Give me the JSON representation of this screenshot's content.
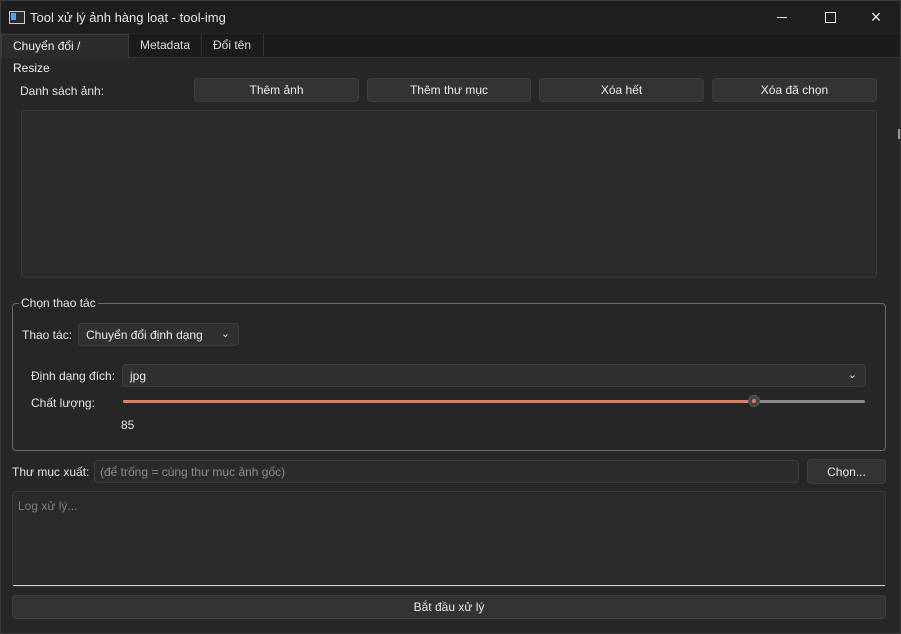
{
  "window": {
    "title": "Tool xử lý ảnh hàng loạt - tool-img",
    "controls": {
      "minimize": "minimize-icon",
      "maximize": "maximize-icon",
      "close": "close-icon"
    }
  },
  "tabs": [
    {
      "label": "Chuyển đổi / Resize",
      "active": true
    },
    {
      "label": "Metadata",
      "active": false
    },
    {
      "label": "Đổi tên",
      "active": false
    }
  ],
  "image_list": {
    "label": "Danh sách ảnh:",
    "buttons": [
      "Thêm ảnh",
      "Thêm thư mục",
      "Xóa hết",
      "Xóa đã chọn"
    ]
  },
  "operation_group": {
    "title": "Chọn thao tác",
    "operation_label": "Thao tác:",
    "operation_value": "Chuyển đổi định dạng",
    "format_label": "Định dạng đích:",
    "format_value": "jpg",
    "quality_label": "Chất lượng:",
    "quality_value": "85",
    "quality_fraction": 0.85
  },
  "output": {
    "label": "Thư mục xuất:",
    "placeholder": "(để trống = cùng thư mục ảnh gốc)",
    "choose_button": "Chọn..."
  },
  "log": {
    "placeholder": "Log xử lý..."
  },
  "start_button": "Bắt đầu xử lý",
  "colors": {
    "accent": "#e27c66",
    "background": "#262626"
  }
}
